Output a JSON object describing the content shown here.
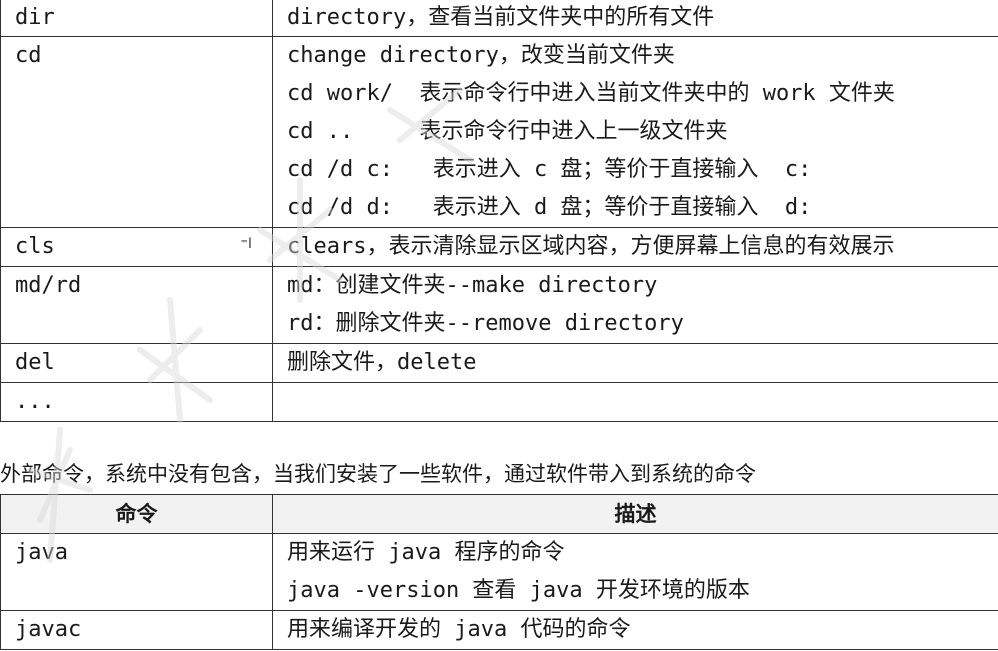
{
  "internal_table": {
    "rows": [
      {
        "cmd": "dir",
        "desc": [
          "directory，查看当前文件夹中的所有文件"
        ]
      },
      {
        "cmd": "cd",
        "desc": [
          "change directory，改变当前文件夹",
          "cd work/  表示命令行中进入当前文件夹中的 work 文件夹",
          "cd ..     表示命令行中进入上一级文件夹",
          "cd /d c:   表示进入 c 盘；等价于直接输入  c:",
          "cd /d d:   表示进入 d 盘；等价于直接输入  d:"
        ]
      },
      {
        "cmd": "cls",
        "desc": [
          "clears，表示清除显示区域内容，方便屏幕上信息的有效展示"
        ]
      },
      {
        "cmd": "md/rd",
        "desc": [
          "md：创建文件夹--make directory",
          "rd：删除文件夹--remove directory"
        ]
      },
      {
        "cmd": "del",
        "desc": [
          "删除文件，delete"
        ]
      },
      {
        "cmd": "...",
        "desc": [
          ""
        ]
      }
    ]
  },
  "external_caption": "外部命令，系统中没有包含，当我们安装了一些软件，通过软件带入到系统的命令",
  "external_table": {
    "headers": {
      "command": "命令",
      "description": "描述"
    },
    "rows": [
      {
        "cmd": "java",
        "desc": [
          "用来运行 java 程序的命令",
          "java -version 查看 java 开发环境的版本"
        ]
      },
      {
        "cmd": "javac",
        "desc": [
          "用来编译开发的 java 代码的命令"
        ]
      }
    ]
  },
  "icons": {
    "cursor": "text-cursor-icon"
  }
}
